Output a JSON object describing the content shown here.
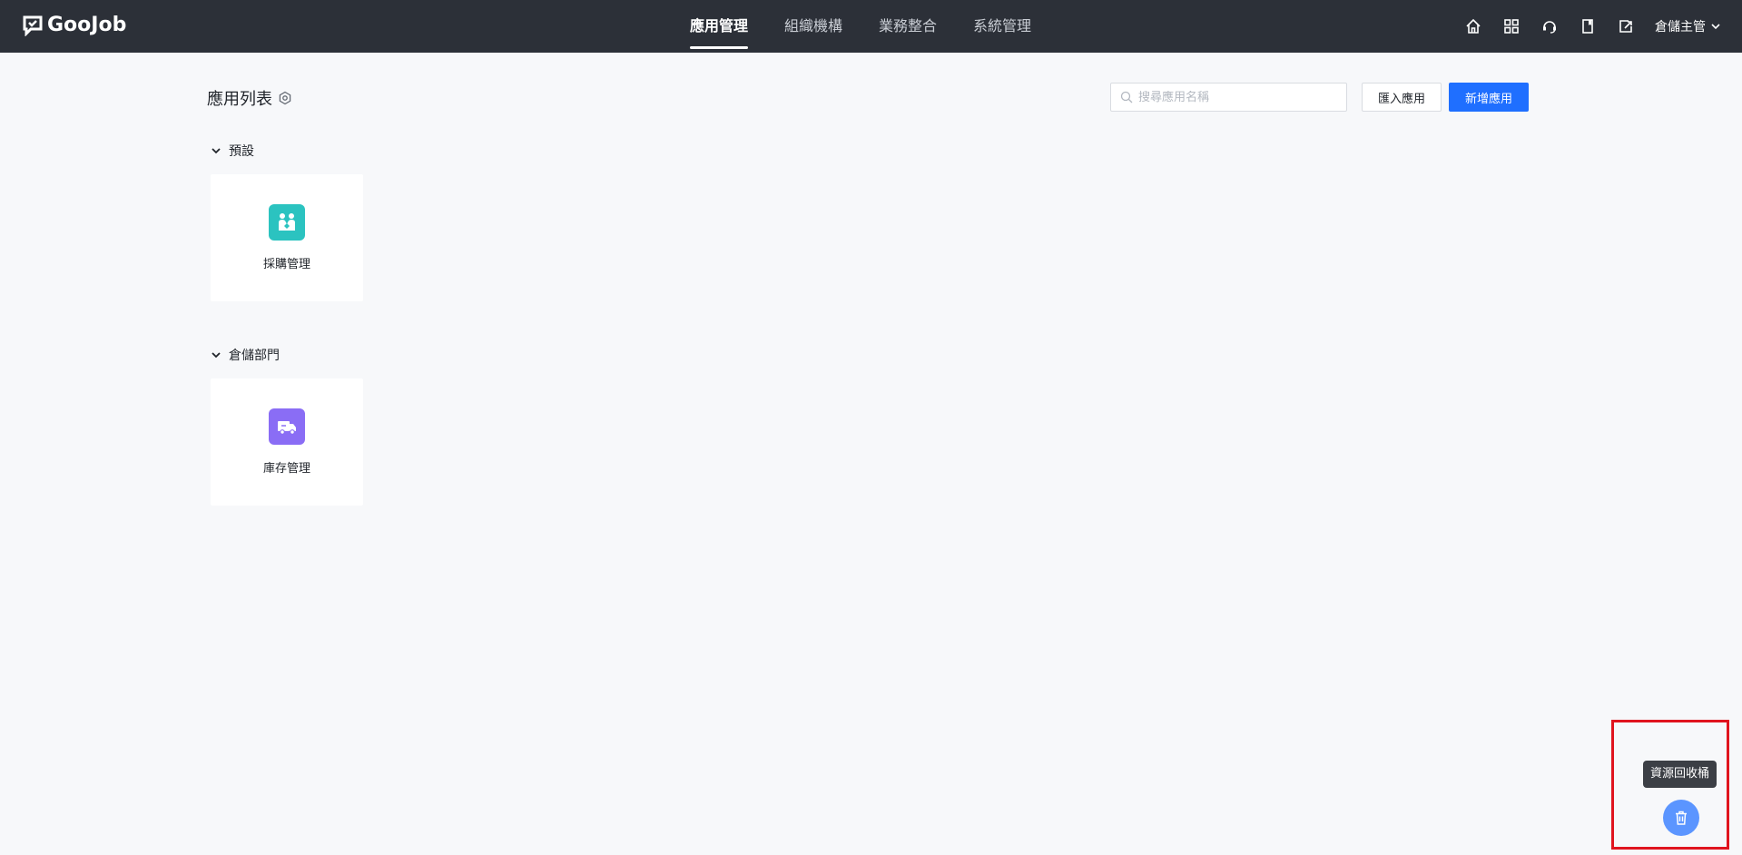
{
  "header": {
    "logo_text": "GooJob",
    "nav": [
      {
        "label": "應用管理",
        "active": true
      },
      {
        "label": "組織機構",
        "active": false
      },
      {
        "label": "業務整合",
        "active": false
      },
      {
        "label": "系統管理",
        "active": false
      }
    ],
    "icons": [
      "home-icon",
      "grid-icon",
      "headset-icon",
      "book-icon",
      "export-icon"
    ],
    "user_name": "倉儲主管"
  },
  "page": {
    "title": "應用列表",
    "search_placeholder": "搜尋應用名稱",
    "import_label": "匯入應用",
    "new_label": "新增應用"
  },
  "groups": [
    {
      "name": "預設",
      "apps": [
        {
          "label": "採購管理",
          "icon": "handshake-icon",
          "color": "#2bc3c0"
        }
      ]
    },
    {
      "name": "倉儲部門",
      "apps": [
        {
          "label": "庫存管理",
          "icon": "delivery-truck-icon",
          "color": "#8a6df5"
        }
      ]
    }
  ],
  "recycle": {
    "tooltip": "資源回收桶",
    "icon": "trash-icon"
  },
  "colors": {
    "header_bg": "#2c3038",
    "primary": "#1f6fff",
    "highlight_frame": "#e0141e"
  }
}
